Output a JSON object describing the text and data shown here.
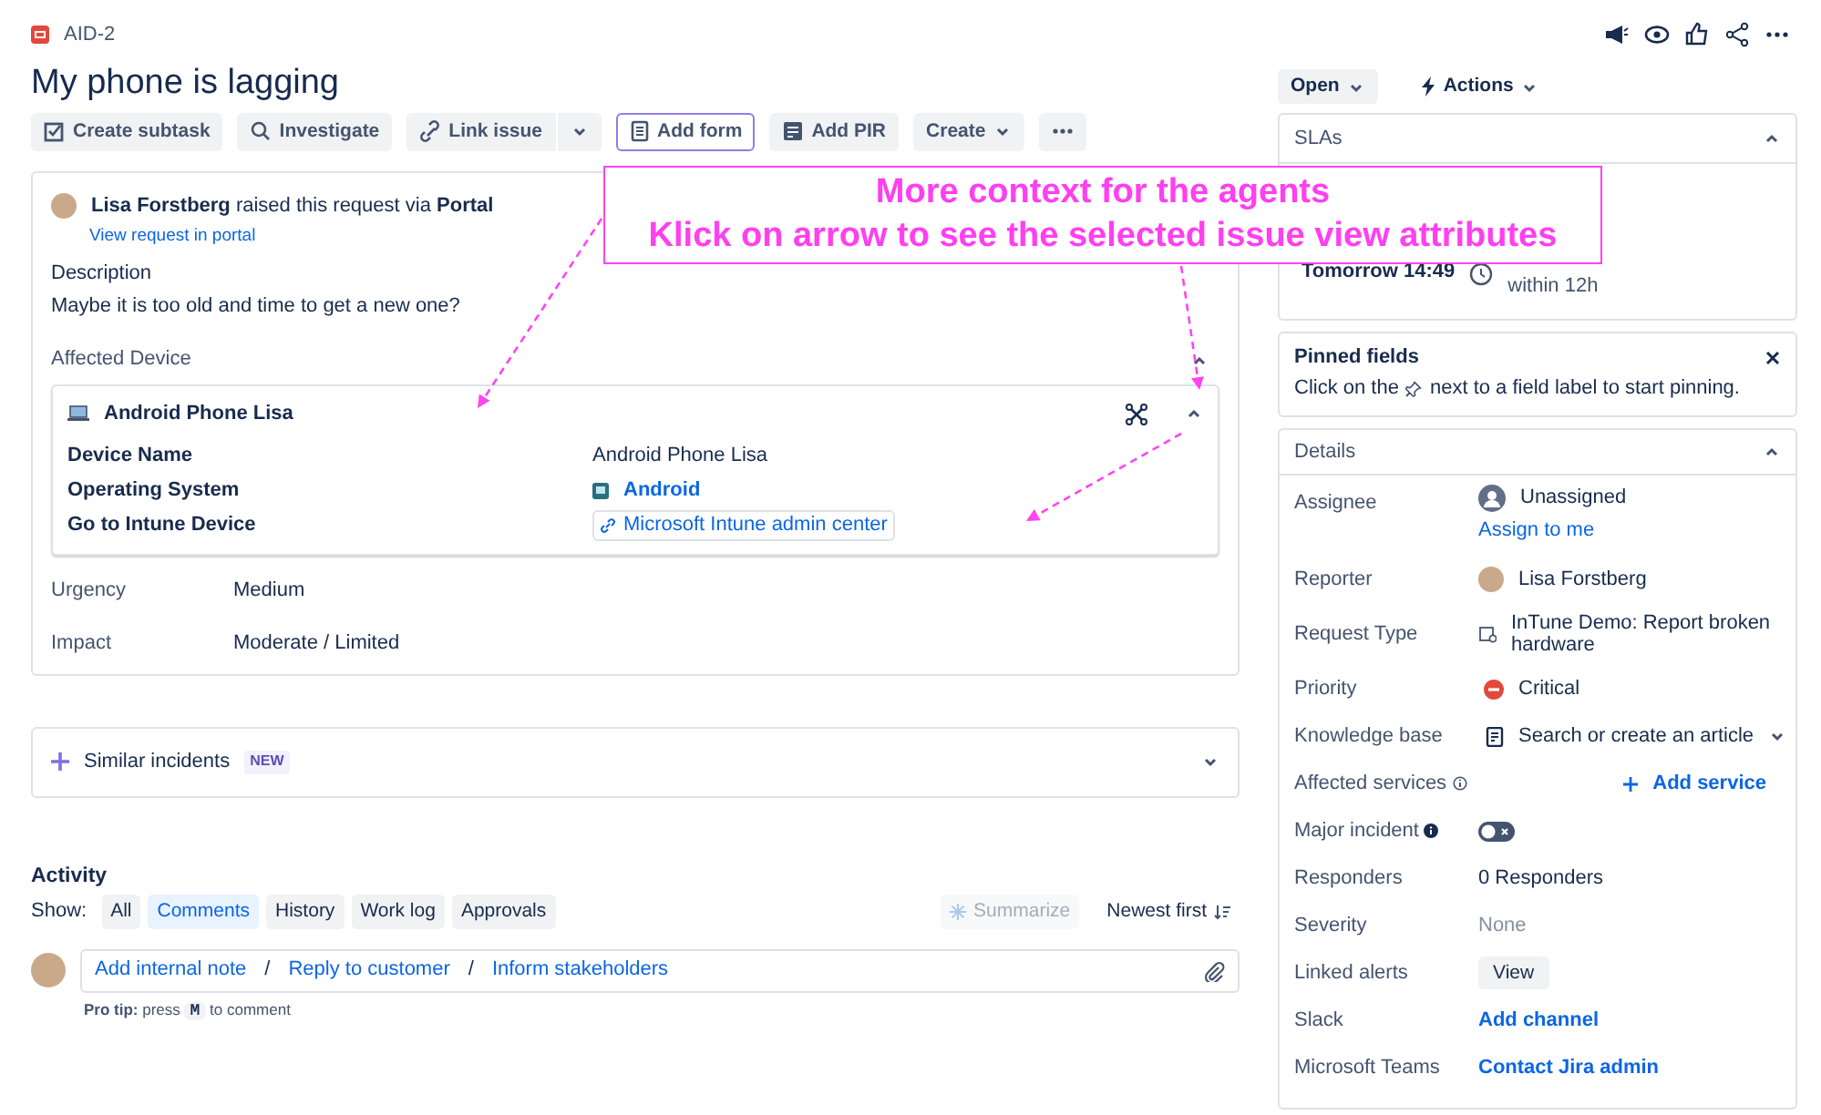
{
  "issue": {
    "key": "AID-2",
    "title": "My phone is lagging"
  },
  "toolbar": [
    {
      "label": "Create subtask",
      "kind": "subtask",
      "focused": false
    },
    {
      "label": "Investigate",
      "kind": "search",
      "focused": false
    },
    {
      "label": "Link issue",
      "kind": "link",
      "focused": false
    },
    {
      "label": "Add form",
      "kind": "form",
      "focused": true
    },
    {
      "label": "Add PIR",
      "kind": "pir",
      "focused": false
    },
    {
      "label": "Create",
      "kind": "create",
      "focused": false
    }
  ],
  "request": {
    "raised_text": "**Lisa Forstberg** raised this request via **Portal**",
    "portal_link": "View request in portal",
    "description_label": "Description",
    "description": "Maybe it is too old and time to get a new one?"
  },
  "affected_device": {
    "label": "Affected Device",
    "expanded": true,
    "device": {
      "name": "Android Phone Lisa",
      "expanded": true,
      "rows": [
        {
          "label": "Device Name",
          "value": "Android Phone Lisa",
          "kind": "text"
        },
        {
          "label": "Operating System",
          "value": "Android",
          "kind": "os"
        },
        {
          "label": "Go to Intune Device",
          "value": "Microsoft Intune admin center",
          "kind": "link"
        }
      ]
    }
  },
  "fields": [
    {
      "label": "Urgency",
      "value": "Medium"
    },
    {
      "label": "Impact",
      "value": "Moderate / Limited"
    }
  ],
  "similar": {
    "label": "Similar incidents",
    "badge": "NEW",
    "expanded": false
  },
  "activity": {
    "title": "Activity",
    "show_label": "Show:",
    "filters": [
      {
        "label": "All",
        "selected": false
      },
      {
        "label": "Comments",
        "selected": true
      },
      {
        "label": "History",
        "selected": false
      },
      {
        "label": "Work log",
        "selected": false
      },
      {
        "label": "Approvals",
        "selected": false
      }
    ],
    "summarize": {
      "label": "Summarize",
      "disabled": true
    },
    "sort": "Newest first",
    "comment_actions": [
      "Add internal note",
      "Reply to customer",
      "Inform stakeholders"
    ],
    "separator": "/",
    "pro_tip": {
      "before": "**Pro tip:** press",
      "key": "M",
      "after": "to comment"
    }
  },
  "status": {
    "label": "Open"
  },
  "actions": {
    "label": "Actions"
  },
  "slas": {
    "title": "SLAs",
    "expanded": true,
    "items": [
      {
        "time": "Tomorrow 14:49",
        "goal": "within 12h"
      }
    ]
  },
  "pinned": {
    "title": "Pinned fields",
    "hint_before": "Click on the",
    "hint_after": "next to a field label to start pinning."
  },
  "details": {
    "title": "Details",
    "expanded": true,
    "fields": [
      {
        "label": "Assignee",
        "kind": "assignee",
        "value": "Unassigned",
        "link": "Assign to me"
      },
      {
        "label": "Reporter",
        "kind": "user",
        "value": "Lisa Forstberg"
      },
      {
        "label": "Request Type",
        "kind": "request_type",
        "value": "InTune Demo: Report broken hardware"
      },
      {
        "label": "Priority",
        "kind": "priority",
        "value": "Critical"
      },
      {
        "label": "Knowledge base",
        "kind": "knowledge",
        "value": "Search or create an article"
      },
      {
        "label": "Affected services",
        "kind": "add",
        "value": "Add service"
      },
      {
        "label": "Major incident",
        "kind": "toggle",
        "on": false
      },
      {
        "label": "Responders",
        "kind": "text",
        "value": "0 Responders"
      },
      {
        "label": "Severity",
        "kind": "muted",
        "value": "None"
      },
      {
        "label": "Linked alerts",
        "kind": "button",
        "value": "View"
      },
      {
        "label": "Slack",
        "kind": "link",
        "value": "Add channel"
      },
      {
        "label": "Microsoft Teams",
        "kind": "link",
        "value": "Contact Jira admin"
      }
    ]
  },
  "annotation": {
    "lines": [
      "More context for the agents",
      "Klick on arrow to see the selected issue view attributes"
    ]
  }
}
